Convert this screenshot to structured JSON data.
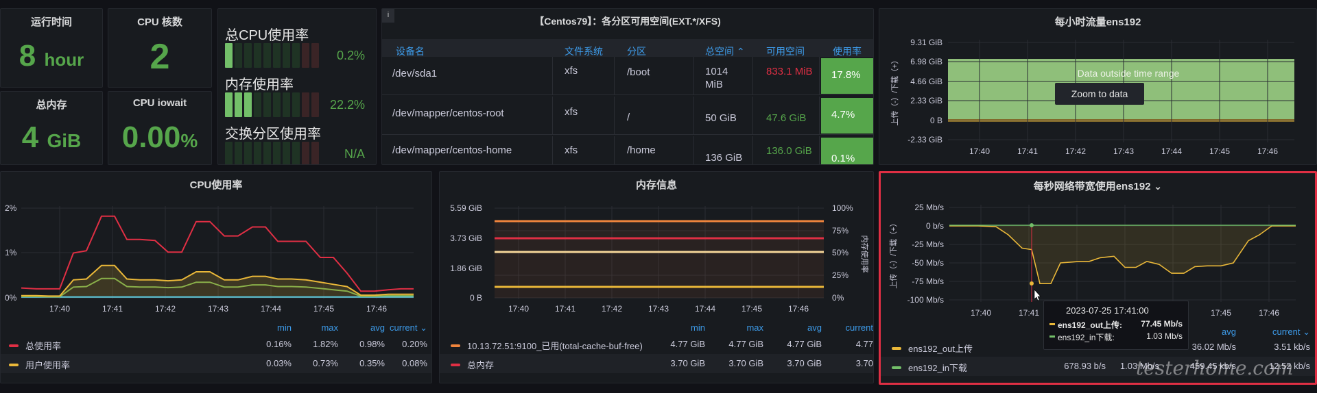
{
  "stats": {
    "uptime": {
      "title": "运行时间",
      "value": "8",
      "unit": "hour"
    },
    "cpu_cores": {
      "title": "CPU 核数",
      "value": "2"
    },
    "total_mem": {
      "title": "总内存",
      "value": "4",
      "unit": "GiB"
    },
    "iowait": {
      "title": "CPU iowait",
      "value": "0.00",
      "unit": "%"
    }
  },
  "gauges": [
    {
      "label": "总CPU使用率",
      "value": "0.2%",
      "level": 0.02
    },
    {
      "label": "内存使用率",
      "value": "22.2%",
      "level": 0.222
    },
    {
      "label": "交换分区使用率",
      "value": "N/A",
      "level": 0
    }
  ],
  "disk_table": {
    "title": "【Centos79】：各分区可用空间(EXT.*/XFS)",
    "info_icon": "i",
    "headers": [
      "设备名",
      "文件系统",
      "分区",
      "总空间 ⌃",
      "可用空间",
      "使用率"
    ],
    "rows": [
      {
        "device": "/dev/sda1",
        "fs": "xfs",
        "mount": "/boot",
        "total": "1014 MiB",
        "avail": "833.1 MiB",
        "used": "17.8%",
        "avail_color": "#e02f44"
      },
      {
        "device": "/dev/mapper/centos-root",
        "fs": "xfs",
        "mount": "/",
        "total": "50 GiB",
        "avail": "47.6 GiB",
        "used": "4.7%",
        "avail_color": "#56a64b"
      },
      {
        "device": "/dev/mapper/centos-home",
        "fs": "xfs",
        "mount": "/home",
        "total": "136 GiB",
        "avail": "136.0 GiB",
        "used": "0.1%",
        "avail_color": "#56a64b"
      }
    ]
  },
  "hourly_traffic": {
    "title": "每小时流量ens192",
    "y_ticks": [
      "9.31 GiB",
      "6.98 GiB",
      "4.66 GiB",
      "2.33 GiB",
      "0 B",
      "-2.33 GiB"
    ],
    "x_ticks": [
      "17:40",
      "17:41",
      "17:42",
      "17:43",
      "17:44",
      "17:45",
      "17:46"
    ],
    "ylabel": "上传（-）/下载（+）",
    "notice": "Data outside time range",
    "zoom_label": "Zoom to data"
  },
  "cpu_chart": {
    "title": "CPU使用率",
    "y_ticks": [
      "2%",
      "1%",
      "0%"
    ],
    "x_ticks": [
      "17:40",
      "17:41",
      "17:42",
      "17:43",
      "17:44",
      "17:45",
      "17:46"
    ],
    "legend_headers": [
      "min",
      "max",
      "avg",
      "current ⌄"
    ],
    "legend": [
      {
        "name": "总使用率",
        "color": "#e02f44",
        "min": "0.16%",
        "max": "1.82%",
        "avg": "0.98%",
        "current": "0.20%"
      },
      {
        "name": "用户使用率",
        "color": "#eab839",
        "min": "0.03%",
        "max": "0.73%",
        "avg": "0.35%",
        "current": "0.08%"
      }
    ]
  },
  "mem_chart": {
    "title": "内存信息",
    "y_ticks": [
      "5.59 GiB",
      "3.73 GiB",
      "1.86 GiB",
      "0 B"
    ],
    "y2_ticks": [
      "100%",
      "75%",
      "50%",
      "25%",
      "0%"
    ],
    "y2label": "内存使用率",
    "x_ticks": [
      "17:40",
      "17:41",
      "17:42",
      "17:43",
      "17:44",
      "17:45",
      "17:46"
    ],
    "legend_headers": [
      "min",
      "max",
      "avg",
      "current"
    ],
    "legend": [
      {
        "name": "10.13.72.51:9100_已用(total-cache-buf-free)",
        "color": "#ef843c",
        "min": "4.77 GiB",
        "max": "4.77 GiB",
        "avg": "4.77 GiB",
        "current": "4.77"
      },
      {
        "name": "总内存",
        "color": "#e02f44",
        "min": "3.70 GiB",
        "max": "3.70 GiB",
        "avg": "3.70 GiB",
        "current": "3.70"
      }
    ]
  },
  "bandwidth_chart": {
    "title": "每秒网络带宽使用ens192 ⌄",
    "y_ticks": [
      "25 Mb/s",
      "0 b/s",
      "-25 Mb/s",
      "-50 Mb/s",
      "-75 Mb/s",
      "-100 Mb/s"
    ],
    "x_ticks": [
      "17:40",
      "17:41",
      "17:42",
      "17:43",
      "17:44",
      "17:45",
      "17:46"
    ],
    "ylabel": "上传（-）/下载（+）",
    "tooltip": {
      "time": "2023-07-25 17:41:00",
      "rows": [
        {
          "name": "ens192_out上传:",
          "value": "77.45 Mb/s",
          "color": "#eab839"
        },
        {
          "name": "ens192_in下载:",
          "value": "1.03 Mb/s",
          "color": "#73bf69"
        }
      ]
    },
    "legend_headers": [
      "avg",
      "current ⌄"
    ],
    "legend": [
      {
        "name": "ens192_out上传",
        "color": "#eab839",
        "avg": "36.02 Mb/s",
        "current": "3.51 kb/s"
      },
      {
        "name": "ens192_in下载",
        "color": "#73bf69",
        "min": "678.93 b/s",
        "max": "1.03 Mb/s",
        "avg": "459.45 kb/s",
        "current": "12.52 kb/s"
      }
    ]
  },
  "watermark": "testerhome.com",
  "colors": {
    "accent_green": "#56a64b",
    "highlight_border": "#e02f44",
    "header_blue": "#3d9be9"
  }
}
